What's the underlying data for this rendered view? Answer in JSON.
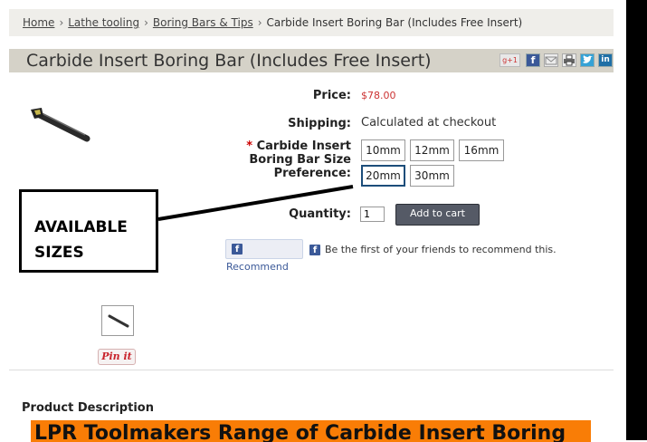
{
  "breadcrumb": {
    "home": "Home",
    "lathe": "Lathe tooling",
    "boring": "Boring Bars & Tips",
    "current": "Carbide Insert Boring Bar (Includes Free Insert)",
    "separator": "›"
  },
  "product": {
    "title": "Carbide Insert Boring Bar (Includes Free Insert)",
    "price_label": "Price:",
    "price": "$78.00",
    "shipping_label": "Shipping:",
    "shipping_value": "Calculated at checkout",
    "option_required_mark": "*",
    "option_label_1": "Carbide Insert",
    "option_label_2": "Boring Bar Size",
    "option_label_3": "Preference:",
    "options": [
      "10mm",
      "12mm",
      "16mm",
      "20mm",
      "30mm"
    ],
    "selected_option": "20mm",
    "quantity_label": "Quantity:",
    "quantity_value": "1",
    "add_to_cart": "Add to cart"
  },
  "share": {
    "gplus": "g+1",
    "facebook": "f"
  },
  "facebook": {
    "recommend_label": "Recommend",
    "friends_text": "Be the first of your friends to recommend this.",
    "icon": "f"
  },
  "annotation": {
    "line1": "AVAILABLE",
    "line2": "SIZES"
  },
  "pinterest": {
    "label": "Pin it"
  },
  "description": {
    "label": "Product Description",
    "banner": "LPR Toolmakers Range of Carbide Insert Boring"
  },
  "colors": {
    "price": "#cc3333",
    "banner": "#f97d06",
    "cart_button": "#555a66",
    "title_bar": "#d5d2c8"
  }
}
